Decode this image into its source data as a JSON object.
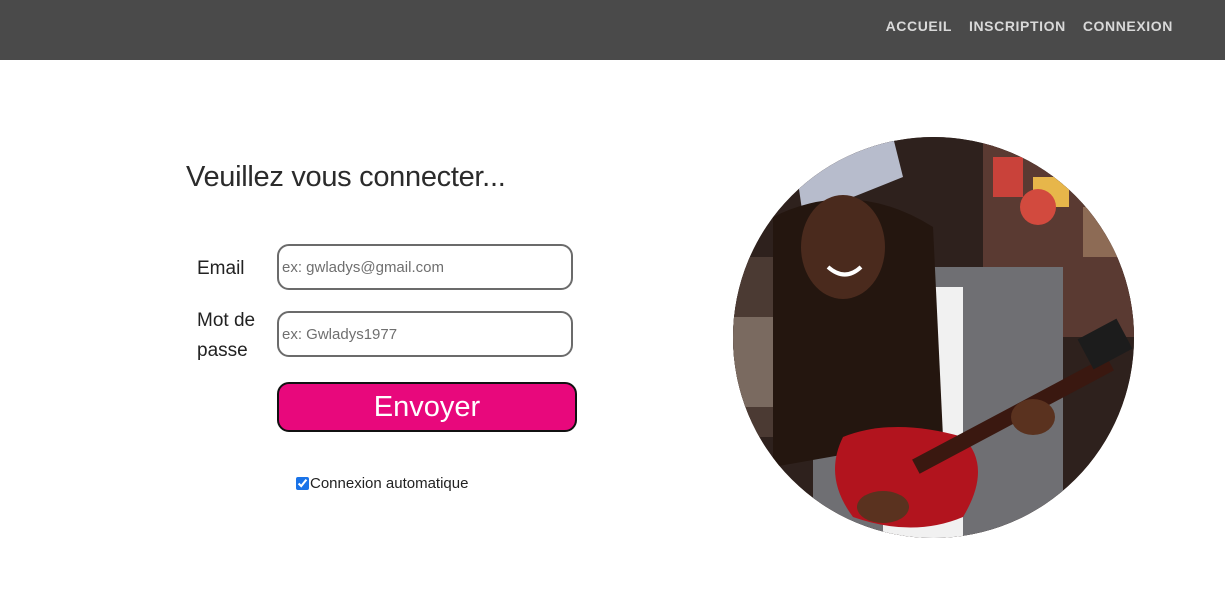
{
  "nav": {
    "items": [
      {
        "label": "ACCUEIL"
      },
      {
        "label": "INSCRIPTION"
      },
      {
        "label": "CONNEXION"
      }
    ]
  },
  "form": {
    "title": "Veuillez vous connecter...",
    "email_label": "Email",
    "email_value": "",
    "email_placeholder": "ex: gwladys@gmail.com",
    "password_label": "Mot de passe",
    "password_value": "",
    "password_placeholder": "ex: Gwladys1977",
    "submit_label": "Envoyer",
    "remember_label": "Connexion automatique",
    "remember_checked": true
  },
  "photo": {
    "subject": "woman-playing-red-electric-guitar"
  },
  "colors": {
    "topbar": "#4a4a4a",
    "nav_text": "#d9d9d9",
    "submit_bg": "#e8087c",
    "field_border": "#6b6b6b"
  }
}
